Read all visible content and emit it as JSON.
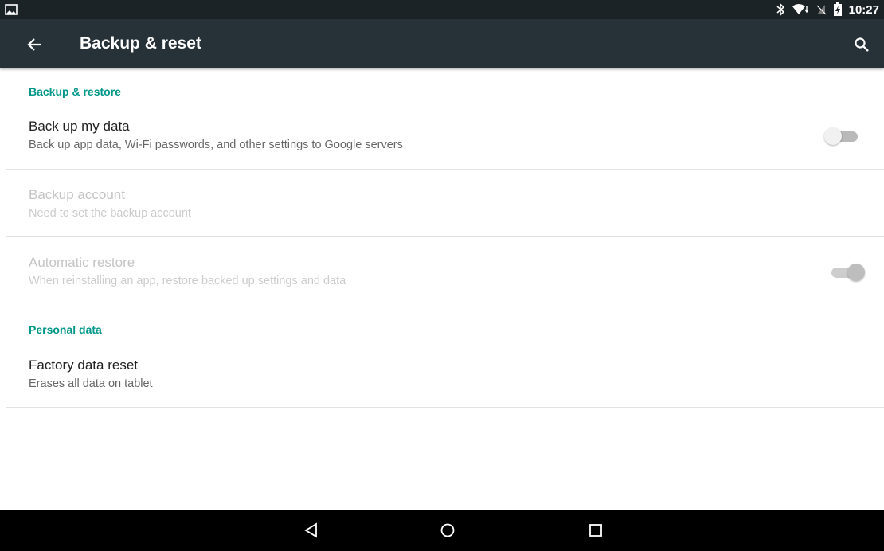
{
  "status_bar": {
    "time": "10:27",
    "icons": [
      "gallery-icon",
      "bluetooth-icon",
      "wifi-icon",
      "no-sim-icon",
      "battery-charging-icon"
    ]
  },
  "toolbar": {
    "title": "Backup & reset",
    "back_icon": "arrow-back-icon",
    "search_icon": "search-icon",
    "background": "#263238"
  },
  "sections": {
    "backup_restore": {
      "header": "Backup & restore",
      "items": [
        {
          "title": "Back up my data",
          "summary": "Back up app data, Wi-Fi passwords, and other settings to Google servers",
          "switch": "off",
          "enabled": true
        },
        {
          "title": "Backup account",
          "summary": "Need to set the backup account",
          "enabled": false
        },
        {
          "title": "Automatic restore",
          "summary": "When reinstalling an app, restore backed up settings and data",
          "switch": "on",
          "enabled": false
        }
      ]
    },
    "personal_data": {
      "header": "Personal data",
      "items": [
        {
          "title": "Factory data reset",
          "summary": "Erases all data on tablet",
          "enabled": true
        }
      ]
    }
  },
  "accent_color": "#009688",
  "nav_bar": {
    "buttons": [
      "back-triangle-icon",
      "home-circle-icon",
      "recents-square-icon"
    ]
  }
}
